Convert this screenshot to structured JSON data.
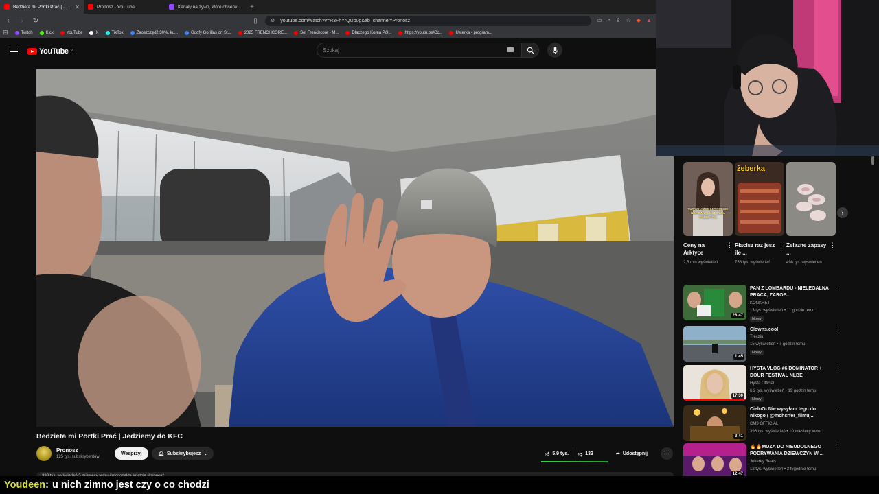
{
  "browser": {
    "tabs": [
      {
        "title": "Bedzieta mi Portki Prać | Jedzi...",
        "active": true,
        "favicon_color": "#ff0000"
      },
      {
        "title": "Pronosz - YouTube",
        "active": false,
        "favicon_color": "#ff0000"
      },
      {
        "title": "Kanały na żywo, które obserwujesz -",
        "active": false,
        "favicon_color": "#9146ff"
      }
    ],
    "new_tab": "+",
    "url": "youtube.com/watch?v=R3FhYrQUp0g&ab_channel=Pronosz",
    "bookmarks": [
      {
        "label": "Twitch",
        "color": "#9146ff"
      },
      {
        "label": "Kick",
        "color": "#53fc18"
      },
      {
        "label": "YouTube",
        "color": "#ff0000"
      },
      {
        "label": "X",
        "color": "#ffffff"
      },
      {
        "label": "TikTok",
        "color": "#25f4ee"
      },
      {
        "label": "Zaoszczędź 30%, ku...",
        "color": "#3b82f6"
      },
      {
        "label": "Goofy Gorillas on St...",
        "color": "#3b82f6"
      },
      {
        "label": "2025 FRENCHCORE...",
        "color": "#ff0000"
      },
      {
        "label": "Set Frenchcore - M...",
        "color": "#ff0000"
      },
      {
        "label": "Dlaczego Korea Pół...",
        "color": "#ff0000"
      },
      {
        "label": "https://youtu.be/Cc...",
        "color": "#ff0000"
      },
      {
        "label": "Usterka - program...",
        "color": "#ff0000"
      }
    ]
  },
  "youtube": {
    "logo": "YouTube",
    "country": "PL",
    "search_placeholder": "Szukaj"
  },
  "video": {
    "title": "Bedzieta mi Portki Prać | Jedziemy do KFC",
    "channel": "Pronosz",
    "subscribers": "125 tys. subskrybentów",
    "support_label": "Wesprzyj",
    "subscribed_label": "Subskrybujesz",
    "likes": "5,9 tys.",
    "dislikes": "133",
    "share_label": "Udostępnij",
    "description_peek": "393 tys. wyświetleń  5 miesięcy temu  #mcdonalds #patola #pronosz"
  },
  "shorts": [
    {
      "title": "Ceny na Arktyce",
      "views": "2,5 mln wyświetleń",
      "overlay": "TUTAJ KAŻDE LETYKIECIE NAPISANA JEST CENA PRZED I PO"
    },
    {
      "title": "Płacisz raz jesz ile ...",
      "views": "756 tys. wyświetleń",
      "overlay": "żeberka"
    },
    {
      "title": "Żelazne zapasy ...",
      "views": "498 tys. wyświetleń",
      "overlay": ""
    }
  ],
  "recommended": [
    {
      "title": "PAN Z LOMBARDU - NIELEGALNA PRACA, ZAROB...",
      "channel": "KONKRET",
      "meta": "13 tys. wyświetleń • 11 godzin temu",
      "badge": "Nowy",
      "duration": "28:47"
    },
    {
      "title": "Clowns.cool",
      "channel": "Trecziu",
      "meta": "15 wyświetleń • 7 godzin temu",
      "badge": "Nowy",
      "duration": "1:45"
    },
    {
      "title": "HYSTA VLOG #6 DOMINATOR + DOUR FESTIVAL NLBE",
      "channel": "Hysta Official",
      "meta": "6,2 tys. wyświetleń • 19 godzin temu",
      "badge": "Nowy",
      "duration": "17:30"
    },
    {
      "title": "CieloG- Nie wysyłam tego do nikogo ( @mchsrfer_filmuj...",
      "channel": "CM3 OFFICIAL",
      "meta": "396 tys. wyświetleń • 10 miesięcy temu",
      "badge": "",
      "duration": "3:41"
    },
    {
      "title": "🔥🔥MUZA DO NIEUDOLNEGO PODRYWANIA DZIEWCZYN W ...",
      "channel": "Jokerey Beats",
      "meta": "12 tys. wyświetleń • 3 tygodnie temu",
      "badge": "",
      "duration": "12:47"
    }
  ],
  "chat": {
    "user": "Youdeen",
    "separator": ":",
    "message": "u nich zimno jest czy o co chodzi"
  },
  "colors": {
    "yt_red": "#ff0000",
    "background": "#0f0f0f",
    "chat_user": "#d7e04a",
    "like_bar": "#2ab844"
  }
}
